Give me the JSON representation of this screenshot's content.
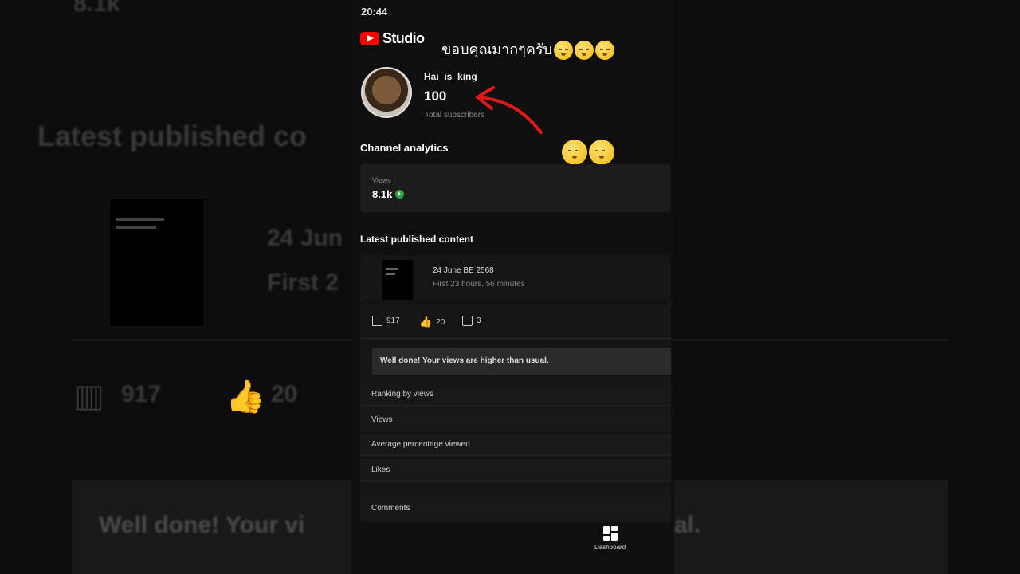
{
  "background": {
    "title_fragment": "Latest published co",
    "date_fragment": "24 Jun",
    "first_fragment": "First 2",
    "views": "917",
    "likes": "20",
    "banner_left": "Well done! Your vi",
    "banner_right": "al.",
    "top_fragment": "8.1k"
  },
  "status": {
    "time": "20:44"
  },
  "app": {
    "logo_text": "Studio",
    "accent": "#ff0000"
  },
  "overlay": {
    "thanks_text": "ขอบคุณมากๆครับ"
  },
  "channel": {
    "name": "Hai_is_king",
    "subscribers": "100",
    "subscribers_label": "Total subscribers"
  },
  "analytics": {
    "heading": "Channel analytics",
    "views_label": "Views",
    "views_value": "8.1k",
    "trend_color": "#2ba640"
  },
  "latest": {
    "heading": "Latest published content",
    "video_title": "24 June BE 2568",
    "video_sub": "First 23 hours, 56 minutes",
    "views": "917",
    "likes": "20",
    "comments": "3",
    "alert": "Well done! Your views are higher than usual.",
    "rows": [
      "Ranking by views",
      "Views",
      "Average percentage viewed",
      "Likes",
      "Comments"
    ]
  },
  "nav": {
    "dashboard_label": "Dashboard",
    "icon": "dashboard-grid-icon"
  }
}
